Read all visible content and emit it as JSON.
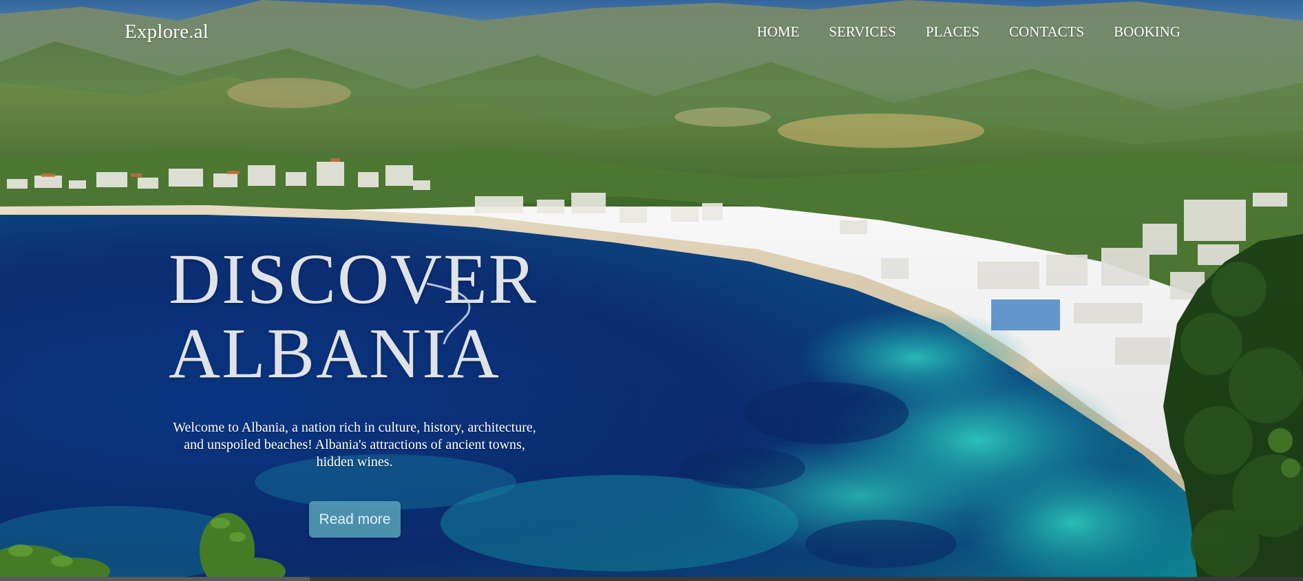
{
  "brand": {
    "name": "Explore.al"
  },
  "nav": {
    "items": [
      {
        "label": "HOME"
      },
      {
        "label": "SERVICES"
      },
      {
        "label": "PLACES"
      },
      {
        "label": "CONTACTS"
      },
      {
        "label": "BOOKING"
      }
    ]
  },
  "hero": {
    "headline_line1": "DISCOVER",
    "headline_line2": "ALBANIA",
    "intro": "Welcome to Albania, a nation rich in culture, history, architecture, and unspoiled beaches! Albania's attractions of ancient towns, hidden wines.",
    "cta_label": "Read more"
  },
  "colors": {
    "sky": "#4a86c0",
    "mountain": "#6f8f5a",
    "deep_sea": "#0b2f7a",
    "turquoise": "#19b6b8",
    "sand": "#e9dcc2",
    "button": "#569eb6"
  }
}
